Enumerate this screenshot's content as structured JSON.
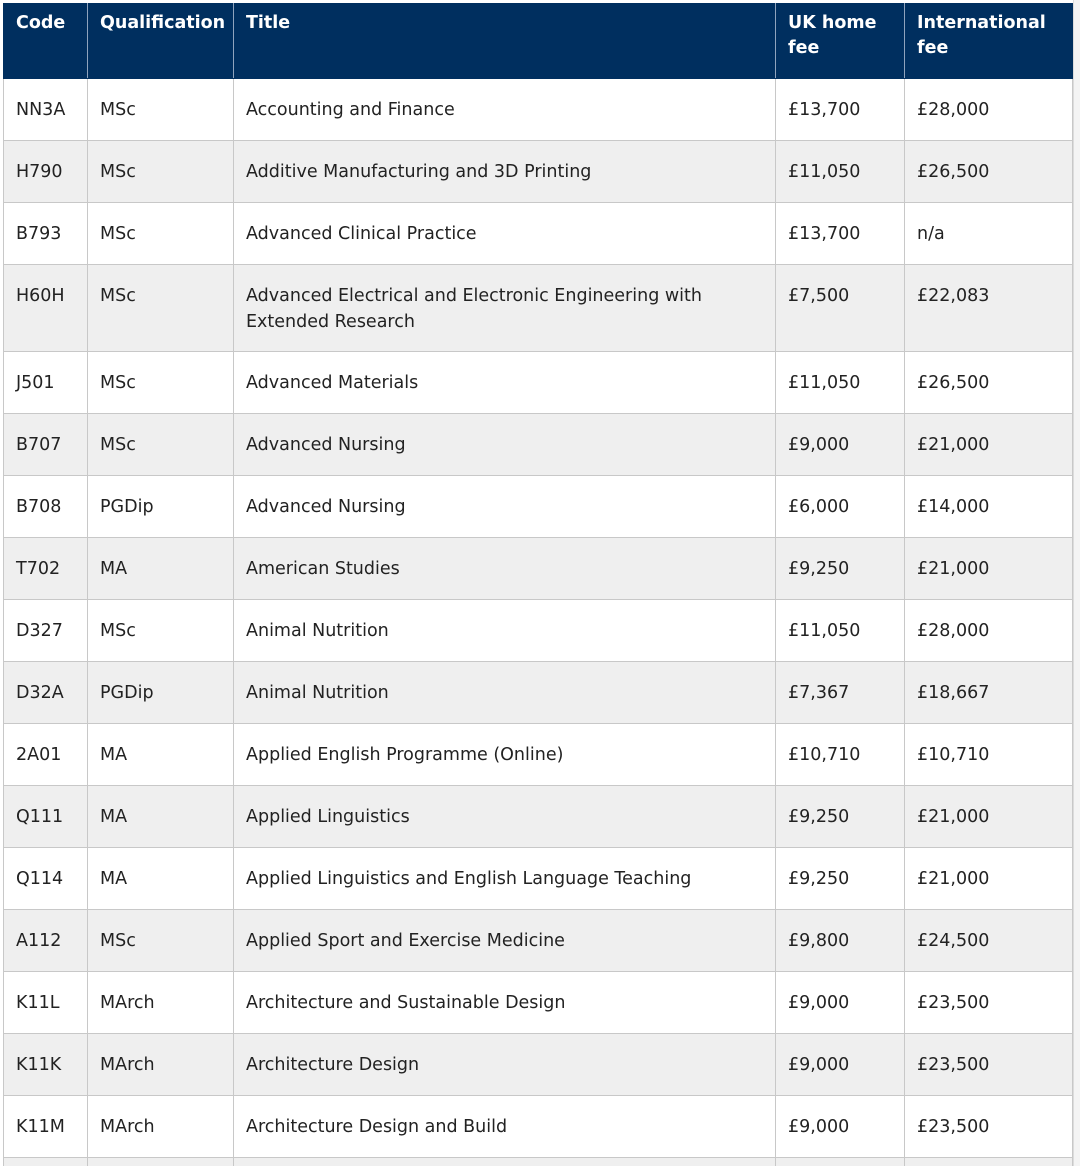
{
  "table": {
    "headers": {
      "code": "Code",
      "qualification": "Qualification",
      "title": "Title",
      "uk_fee": "UK home fee",
      "intl_fee": "International fee"
    },
    "rows": [
      {
        "code": "NN3A",
        "qualification": "MSc",
        "title": "Accounting and Finance",
        "uk_fee": "£13,700",
        "intl_fee": "£28,000"
      },
      {
        "code": "H790",
        "qualification": "MSc",
        "title": "Additive Manufacturing and 3D Printing",
        "uk_fee": "£11,050",
        "intl_fee": "£26,500"
      },
      {
        "code": "B793",
        "qualification": "MSc",
        "title": "Advanced Clinical Practice",
        "uk_fee": "£13,700",
        "intl_fee": "n/a"
      },
      {
        "code": "H60H",
        "qualification": "MSc",
        "title": "Advanced Electrical and Electronic Engineering with Extended Research",
        "uk_fee": "£7,500",
        "intl_fee": "£22,083"
      },
      {
        "code": "J501",
        "qualification": "MSc",
        "title": "Advanced Materials",
        "uk_fee": "£11,050",
        "intl_fee": "£26,500"
      },
      {
        "code": "B707",
        "qualification": "MSc",
        "title": "Advanced Nursing",
        "uk_fee": "£9,000",
        "intl_fee": "£21,000"
      },
      {
        "code": "B708",
        "qualification": "PGDip",
        "title": "Advanced Nursing",
        "uk_fee": "£6,000",
        "intl_fee": "£14,000"
      },
      {
        "code": "T702",
        "qualification": "MA",
        "title": "American Studies",
        "uk_fee": "£9,250",
        "intl_fee": "£21,000"
      },
      {
        "code": "D327",
        "qualification": "MSc",
        "title": "Animal Nutrition",
        "uk_fee": "£11,050",
        "intl_fee": "£28,000"
      },
      {
        "code": "D32A",
        "qualification": "PGDip",
        "title": "Animal Nutrition",
        "uk_fee": "£7,367",
        "intl_fee": "£18,667"
      },
      {
        "code": "2A01",
        "qualification": "MA",
        "title": "Applied English Programme (Online)",
        "uk_fee": "£10,710",
        "intl_fee": "£10,710"
      },
      {
        "code": "Q111",
        "qualification": "MA",
        "title": "Applied Linguistics",
        "uk_fee": "£9,250",
        "intl_fee": "£21,000"
      },
      {
        "code": "Q114",
        "qualification": "MA",
        "title": "Applied Linguistics and English Language Teaching",
        "uk_fee": "£9,250",
        "intl_fee": "£21,000"
      },
      {
        "code": "A112",
        "qualification": "MSc",
        "title": "Applied Sport and Exercise Medicine",
        "uk_fee": "£9,800",
        "intl_fee": "£24,500"
      },
      {
        "code": "K11L",
        "qualification": "MArch",
        "title": "Architecture and Sustainable Design",
        "uk_fee": "£9,000",
        "intl_fee": "£23,500"
      },
      {
        "code": "K11K",
        "qualification": "MArch",
        "title": "Architecture Design",
        "uk_fee": "£9,000",
        "intl_fee": "£23,500"
      },
      {
        "code": "K11M",
        "qualification": "MArch",
        "title": "Architecture Design and Build",
        "uk_fee": "£9,000",
        "intl_fee": "£23,500"
      }
    ]
  },
  "colors": {
    "header_bg": "#002f5f",
    "header_text": "#ffffff",
    "row_alt_bg": "#efefef",
    "border": "#c8c8c8"
  }
}
